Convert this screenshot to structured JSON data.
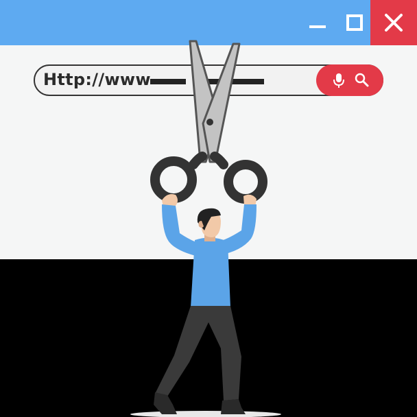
{
  "window": {
    "controls": {
      "minimize": "minimize-icon",
      "maximize": "maximize-icon",
      "close": "close-icon"
    }
  },
  "address_bar": {
    "text": "Http://www",
    "search_icons": [
      "microphone-icon",
      "search-icon"
    ]
  },
  "colors": {
    "titlebar": "#5eaaf1",
    "close_button": "#e33a48",
    "search_button": "#e33a48",
    "window_body": "#f5f6f6",
    "shirt": "#5ba4e8",
    "pants": "#3a3a3a"
  }
}
